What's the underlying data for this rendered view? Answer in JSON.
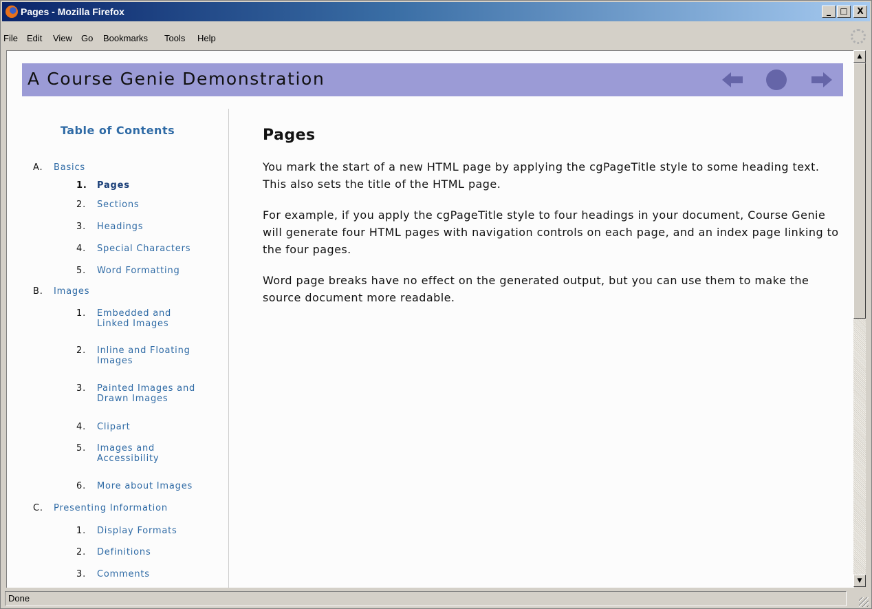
{
  "window": {
    "title": "Pages - Mozilla Firefox",
    "buttons": {
      "minimize": "_",
      "maximize": "□",
      "close": "X"
    }
  },
  "menu": [
    "File",
    "Edit",
    "View",
    "Go",
    "Bookmarks",
    "Tools",
    "Help"
  ],
  "page": {
    "header_title": "A Course Genie Demonstration",
    "toc": {
      "title": "Table of Contents",
      "sections": [
        {
          "num": "A.",
          "label": "Basics",
          "items": [
            {
              "num": "1.",
              "label": "Pages",
              "current": true
            },
            {
              "num": "2.",
              "label": "Sections"
            },
            {
              "num": "3.",
              "label": "Headings"
            },
            {
              "num": "4.",
              "label": "Special Characters"
            },
            {
              "num": "5.",
              "label": "Word Formatting"
            }
          ]
        },
        {
          "num": "B.",
          "label": "Images",
          "items": [
            {
              "num": "1.",
              "label": "Embedded and",
              "label2": "Linked Images"
            },
            {
              "num": "2.",
              "label": "Inline and Floating",
              "label2": "Images"
            },
            {
              "num": "3.",
              "label": "Painted Images and",
              "label2": "Drawn Images"
            },
            {
              "num": "4.",
              "label": "Clipart"
            },
            {
              "num": "5.",
              "label": "Images and",
              "label2": "Accessibility"
            },
            {
              "num": "6.",
              "label": "More about Images"
            }
          ]
        },
        {
          "num": "C.",
          "label": "Presenting Information",
          "items": [
            {
              "num": "1.",
              "label": "Display Formats"
            },
            {
              "num": "2.",
              "label": "Definitions"
            },
            {
              "num": "3.",
              "label": "Comments"
            }
          ]
        }
      ]
    },
    "main": {
      "heading": "Pages",
      "paragraphs": [
        "You mark the start of a new HTML page by applying the cgPageTitle style to some heading text. This also sets the title of the HTML page.",
        "For example, if you apply the cgPageTitle style to four headings in your document, Course Genie will generate four HTML pages with navigation controls on each page, and an index page linking to the four pages.",
        "Word page breaks have no effect on the generated output, but you can use them to make the source document more readable."
      ]
    }
  },
  "status": "Done",
  "colors": {
    "header_bg": "#9b9bd6",
    "nav_icons": "#6565a8",
    "link": "#2e6aa5"
  }
}
